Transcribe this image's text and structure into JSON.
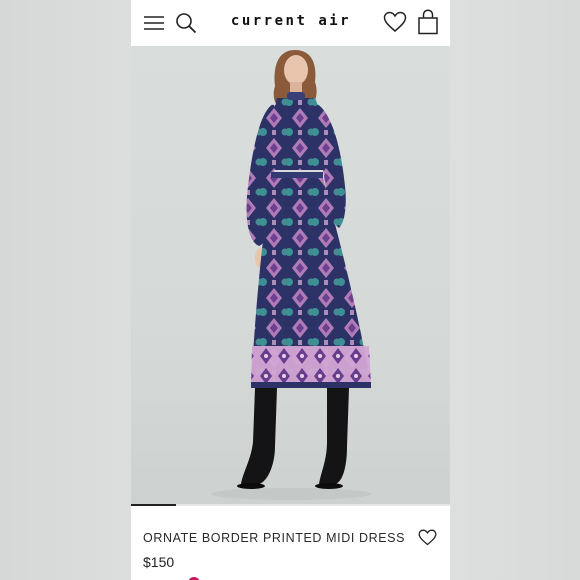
{
  "app": {
    "brand": "current air",
    "icons": {
      "menu": "hamburger-menu-icon",
      "search": "search-icon",
      "wishlist": "heart-icon",
      "bag": "shopping-bag-icon"
    }
  },
  "gallery": {
    "image_description_icon": "product-photo",
    "progress_fraction": 0.14
  },
  "product": {
    "title": "ORNATE BORDER PRINTED MIDI DRESS",
    "price": "$150",
    "wishlist_icon": "heart-outline-icon"
  },
  "colors": {
    "dress_navy": "#2c3266",
    "dress_teal": "#3fa9a0",
    "dress_pink": "#c78ac6",
    "accent": "#c2195d"
  }
}
